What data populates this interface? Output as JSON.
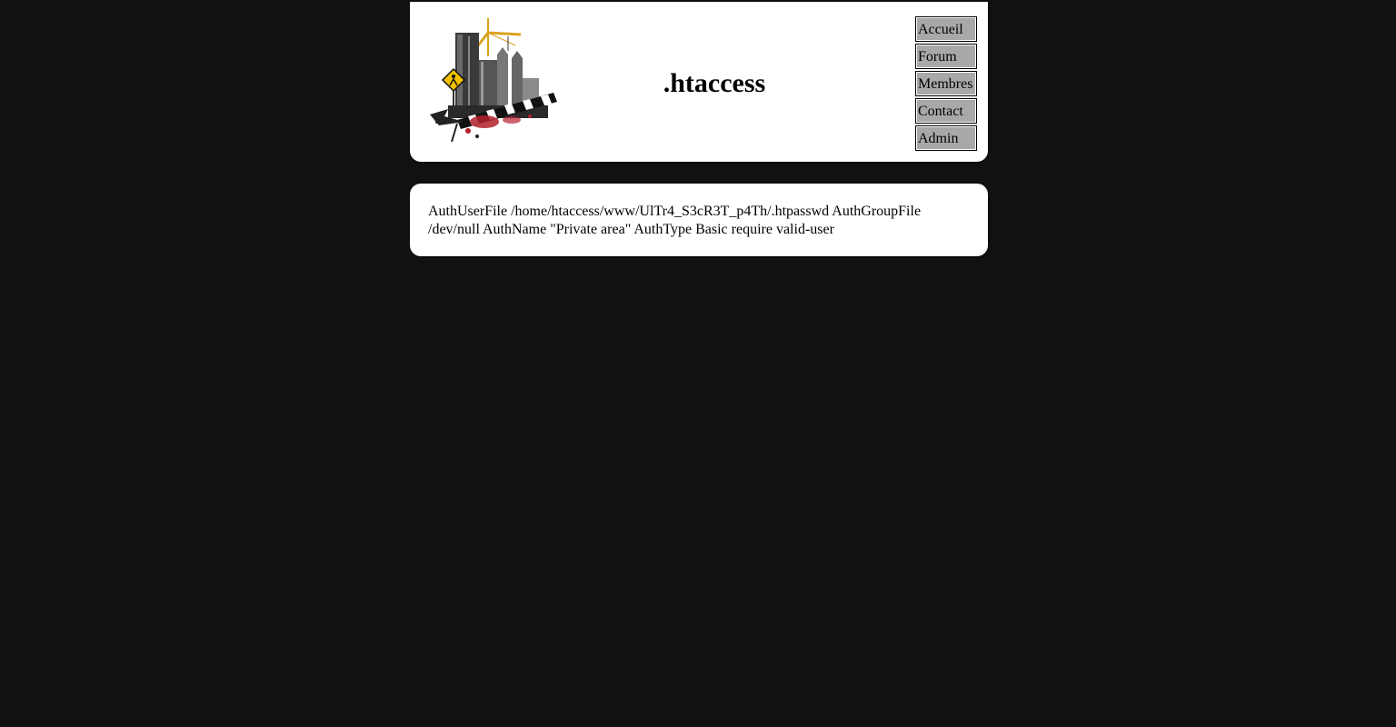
{
  "header": {
    "title": ".htaccess",
    "logo_icon": "construction-city-logo",
    "nav": [
      {
        "label": "Accueil"
      },
      {
        "label": "Forum"
      },
      {
        "label": "Membres"
      },
      {
        "label": "Contact"
      },
      {
        "label": "Admin"
      }
    ]
  },
  "content": {
    "text": "AuthUserFile /home/htaccess/www/UlTr4_S3cR3T_p4Th/.htpasswd AuthGroupFile /dev/null AuthName \"Private area\" AuthType Basic require valid-user"
  },
  "colors": {
    "page_background": "#111111",
    "panel_background": "#ffffff",
    "nav_button_background": "#a8a8a8"
  }
}
